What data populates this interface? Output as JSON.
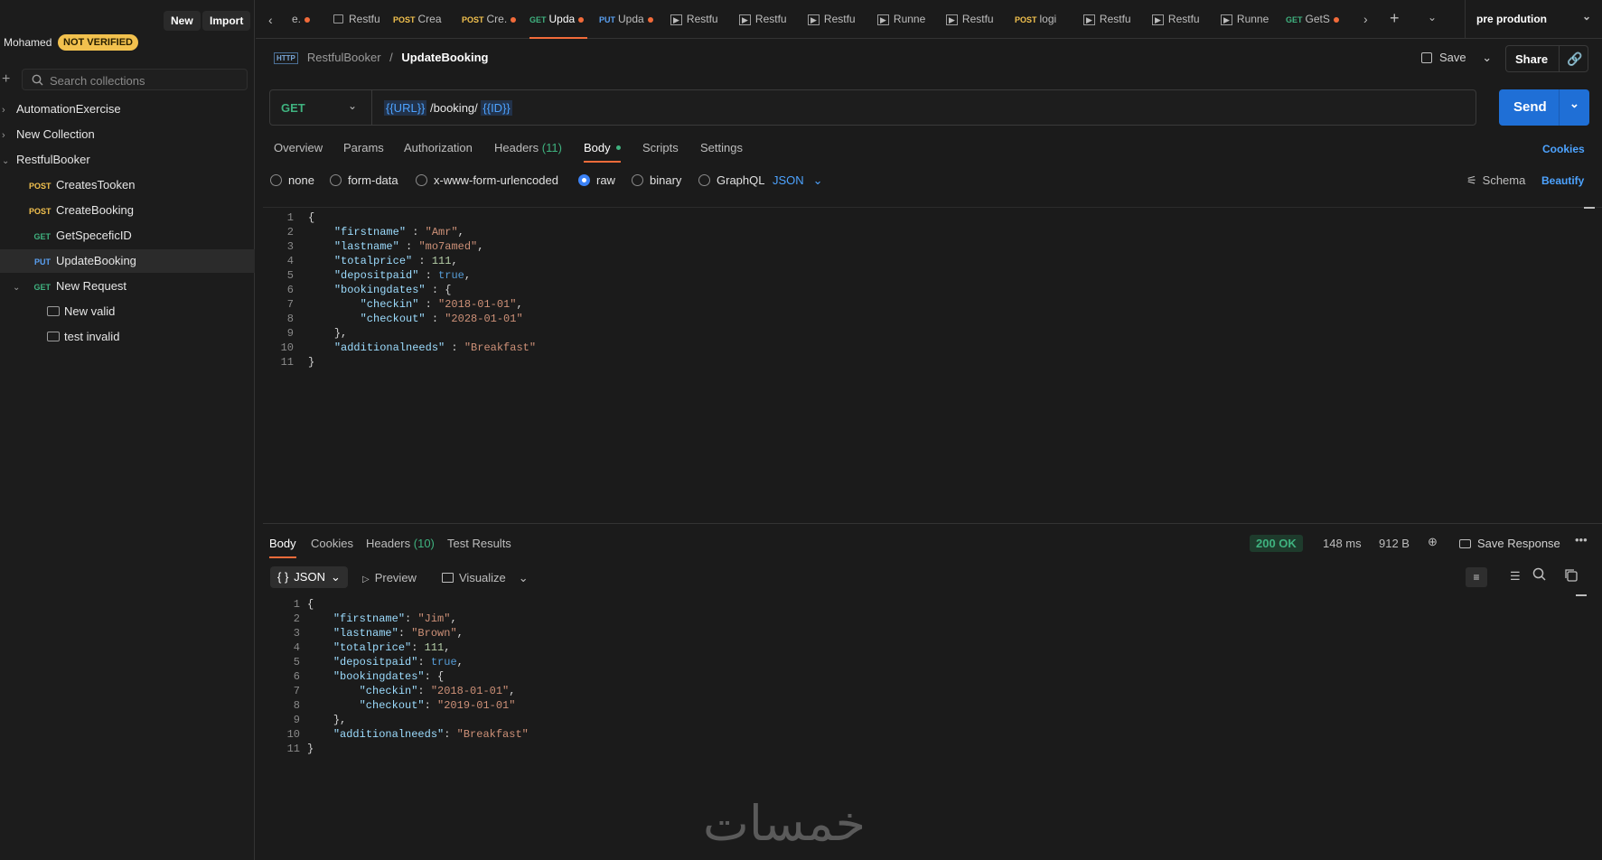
{
  "sidebar": {
    "new_label": "New",
    "import_label": "Import",
    "user_name": "Mohamed",
    "verify_badge": "NOT VERIFIED",
    "search_placeholder": "Search collections",
    "collections": [
      {
        "label": "AutomationExercise"
      },
      {
        "label": "New Collection"
      },
      {
        "label": "RestfulBooker"
      }
    ],
    "requests": [
      {
        "method": "POST",
        "label": "CreatesTooken"
      },
      {
        "method": "POST",
        "label": "CreateBooking"
      },
      {
        "method": "GET",
        "label": "GetSpeceficID"
      },
      {
        "method": "PUT",
        "label": "UpdateBooking"
      },
      {
        "method": "GET",
        "label": "New Request"
      }
    ],
    "examples": [
      {
        "label": "New valid"
      },
      {
        "label": "test invalid"
      }
    ]
  },
  "tabs": [
    {
      "method": "",
      "label": "e."
    },
    {
      "method": "",
      "label": "Restfu"
    },
    {
      "method": "POST",
      "label": "Crea"
    },
    {
      "method": "POST",
      "label": "Cre."
    },
    {
      "method": "GET",
      "label": "Upda"
    },
    {
      "method": "PUT",
      "label": "Upda"
    },
    {
      "method": "",
      "label": "Restfu"
    },
    {
      "method": "",
      "label": "Restfu"
    },
    {
      "method": "",
      "label": "Restfu"
    },
    {
      "method": "",
      "label": "Runne"
    },
    {
      "method": "",
      "label": "Restfu"
    },
    {
      "method": "POST",
      "label": "logi"
    },
    {
      "method": "",
      "label": "Restfu"
    },
    {
      "method": "",
      "label": "Restfu"
    },
    {
      "method": "",
      "label": "Runne"
    },
    {
      "method": "GET",
      "label": "GetS"
    }
  ],
  "environment": "pre prodution",
  "breadcrumb": {
    "parent": "RestfulBooker",
    "sep": "/",
    "current": "UpdateBooking"
  },
  "header_actions": {
    "save": "Save",
    "share": "Share"
  },
  "request": {
    "method": "GET",
    "url_var1": "{{URL}}",
    "url_path": "/booking/",
    "url_var2": "{{ID}}",
    "send": "Send"
  },
  "req_tabs": {
    "overview": "Overview",
    "params": "Params",
    "authorization": "Authorization",
    "headers": "Headers",
    "headers_count": "(11)",
    "body": "Body",
    "scripts": "Scripts",
    "settings": "Settings",
    "cookies": "Cookies"
  },
  "body_types": {
    "none": "none",
    "form_data": "form-data",
    "urlencoded": "x-www-form-urlencoded",
    "raw": "raw",
    "binary": "binary",
    "graphql": "GraphQL",
    "format": "JSON",
    "schema": "Schema",
    "beautify": "Beautify"
  },
  "request_body": [
    {
      "ln": "1",
      "text": "{"
    },
    {
      "ln": "2",
      "text": "    \"firstname\" : \"Amr\","
    },
    {
      "ln": "3",
      "text": "    \"lastname\" : \"mo7amed\","
    },
    {
      "ln": "4",
      "text": "    \"totalprice\" : 111,"
    },
    {
      "ln": "5",
      "text": "    \"depositpaid\" : true,"
    },
    {
      "ln": "6",
      "text": "    \"bookingdates\" : {"
    },
    {
      "ln": "7",
      "text": "        \"checkin\" : \"2018-01-01\","
    },
    {
      "ln": "8",
      "text": "        \"checkout\" : \"2028-01-01\""
    },
    {
      "ln": "9",
      "text": "    },"
    },
    {
      "ln": "10",
      "text": "    \"additionalneeds\" : \"Breakfast\""
    },
    {
      "ln": "11",
      "text": "}"
    }
  ],
  "resp_tabs": {
    "body": "Body",
    "cookies": "Cookies",
    "headers": "Headers",
    "headers_count": "(10)",
    "test_results": "Test Results"
  },
  "response_meta": {
    "status": "200 OK",
    "time": "148 ms",
    "size": "912 B",
    "save_response": "Save Response"
  },
  "response_view": {
    "format": "JSON",
    "preview": "Preview",
    "visualize": "Visualize"
  },
  "response_body": [
    {
      "ln": "1",
      "text": "{"
    },
    {
      "ln": "2",
      "text": "    \"firstname\": \"Jim\","
    },
    {
      "ln": "3",
      "text": "    \"lastname\": \"Brown\","
    },
    {
      "ln": "4",
      "text": "    \"totalprice\": 111,"
    },
    {
      "ln": "5",
      "text": "    \"depositpaid\": true,"
    },
    {
      "ln": "6",
      "text": "    \"bookingdates\": {"
    },
    {
      "ln": "7",
      "text": "        \"checkin\": \"2018-01-01\","
    },
    {
      "ln": "8",
      "text": "        \"checkout\": \"2019-01-01\""
    },
    {
      "ln": "9",
      "text": "    },"
    },
    {
      "ln": "10",
      "text": "    \"additionalneeds\": \"Breakfast\""
    },
    {
      "ln": "11",
      "text": "}"
    }
  ],
  "watermark": "خمسات",
  "colors": {
    "accent": "#f26b3a",
    "send": "#1f6fd6",
    "link": "#4da3ff",
    "status_ok": "#3fb27f"
  }
}
